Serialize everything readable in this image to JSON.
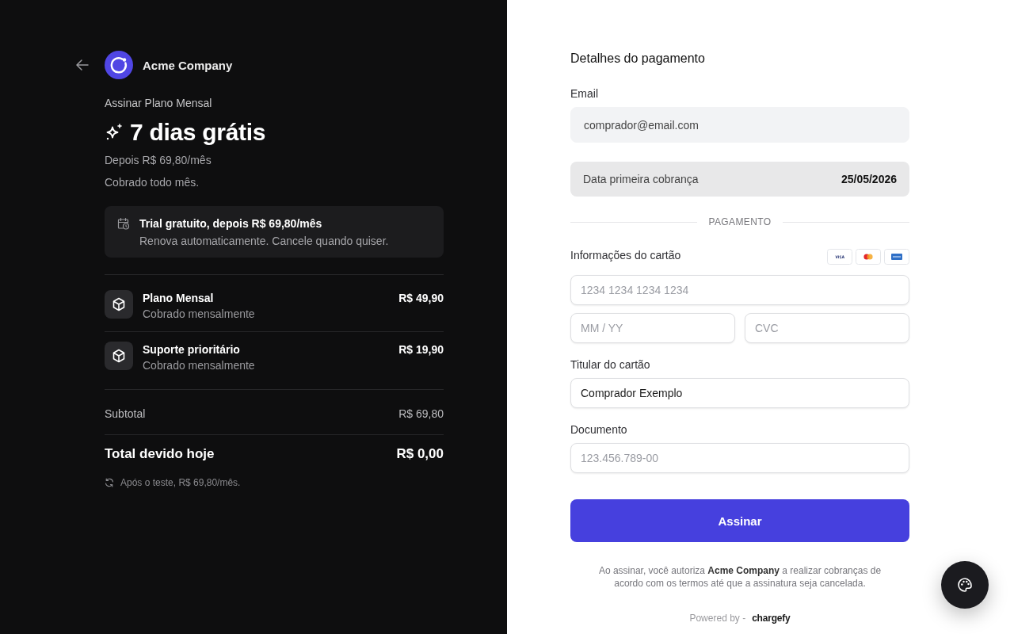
{
  "merchant": {
    "name": "Acme Company"
  },
  "plan": {
    "action": "Assinar Plano Mensal",
    "headline": "7 dias grátis",
    "after_price": "Depois R$ 69,80/mês",
    "billing_note": "Cobrado todo mês."
  },
  "trial_notice": {
    "title": "Trial gratuito, depois R$ 69,80/mês",
    "text": "Renova automaticamente. Cancele quando quiser."
  },
  "line_items": [
    {
      "name": "Plano Mensal",
      "billing": "Cobrado mensalmente",
      "price": "R$ 49,90"
    },
    {
      "name": "Suporte prioritário",
      "billing": "Cobrado mensalmente",
      "price": "R$ 19,90"
    }
  ],
  "subtotal": {
    "label": "Subtotal",
    "value": "R$ 69,80"
  },
  "total": {
    "label": "Total devido hoje",
    "value": "R$ 0,00"
  },
  "renewal_note": "Após o teste, R$ 69,80/mês.",
  "payment": {
    "title": "Detalhes do pagamento",
    "email": {
      "label": "Email",
      "value": "comprador@email.com",
      "readonly": true
    },
    "first_charge": {
      "label": "Data primeira cobrança",
      "value": "25/05/2026"
    },
    "section_divider": "PAGAMENTO",
    "card": {
      "label": "Informações do cartão",
      "number": {
        "placeholder": "1234 1234 1234 1234"
      },
      "expiry": {
        "placeholder": "MM / YY"
      },
      "cvc": {
        "placeholder": "CVC"
      }
    },
    "cardholder": {
      "label": "Titular do cartão",
      "value": "Comprador Exemplo"
    },
    "document": {
      "label": "Documento",
      "placeholder": "123.456.789-00"
    },
    "submit_button": "Assinar",
    "legal_text": "Ao assinar, você autoriza **Acme Company** a realizar cobranças de acordo com os termos até que a assinatura seja cancelada.",
    "powered_by": {
      "text": "Powered by -",
      "brand": "chargefy"
    }
  }
}
